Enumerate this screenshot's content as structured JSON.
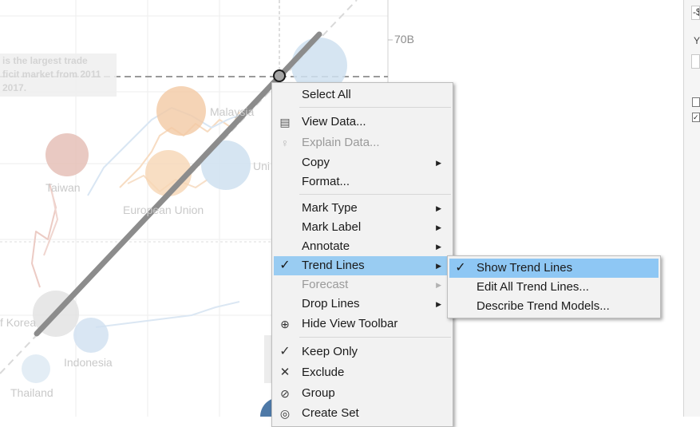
{
  "chart": {
    "y_axis_label": "70B",
    "annotation": "is the largest trade\nficit market from 2011\n2017.",
    "countries": {
      "malaysia": "Malaysia",
      "taiwan": "Taiwan",
      "european_union": "European Union",
      "united_partial": "Uni",
      "korea_partial": "f Korea",
      "indonesia": "Indonesia",
      "thailand": "Thailand"
    },
    "colors": {
      "trend_line": "#8c8c8c",
      "reference_line": "#8c8c8c",
      "bubble_orange": "#f3c9a4",
      "bubble_blue": "#c8dcef",
      "bubble_red": "#e4bbb3",
      "bubble_gray": "#e1e1e1",
      "bubble_dark_blue": "#4e79a7"
    }
  },
  "right_panel": {
    "field_top": "-$",
    "label_y": "Y",
    "check_mark": "✓"
  },
  "context_menu": {
    "items": [
      {
        "label": "Select All",
        "icon": "",
        "enabled": true
      },
      {
        "label": "View Data...",
        "icon": "table-icon",
        "enabled": true
      },
      {
        "label": "Explain Data...",
        "icon": "lightbulb-icon",
        "enabled": false
      },
      {
        "label": "Copy",
        "icon": "",
        "enabled": true,
        "submenu": true
      },
      {
        "label": "Format...",
        "icon": "",
        "enabled": true
      },
      {
        "label": "Mark Type",
        "icon": "",
        "enabled": true,
        "submenu": true
      },
      {
        "label": "Mark Label",
        "icon": "",
        "enabled": true,
        "submenu": true
      },
      {
        "label": "Annotate",
        "icon": "",
        "enabled": true,
        "submenu": true
      },
      {
        "label": "Trend Lines",
        "icon": "check-icon",
        "enabled": true,
        "submenu": true,
        "highlighted": true
      },
      {
        "label": "Forecast",
        "icon": "",
        "enabled": false,
        "submenu": true
      },
      {
        "label": "Drop Lines",
        "icon": "",
        "enabled": true,
        "submenu": true
      },
      {
        "label": "Hide View Toolbar",
        "icon": "zoom-icon",
        "enabled": true
      },
      {
        "label": "Keep Only",
        "icon": "check-icon",
        "enabled": true
      },
      {
        "label": "Exclude",
        "icon": "x-icon",
        "enabled": true
      },
      {
        "label": "Group",
        "icon": "paperclip-icon",
        "enabled": true
      },
      {
        "label": "Create Set",
        "icon": "set-icon",
        "enabled": true
      }
    ]
  },
  "submenu": {
    "items": [
      {
        "label": "Show Trend Lines",
        "icon": "check-icon",
        "highlighted": true
      },
      {
        "label": "Edit All Trend Lines...",
        "icon": ""
      },
      {
        "label": "Describe Trend Models...",
        "icon": ""
      }
    ]
  },
  "glyphs": {
    "check": "✓",
    "cross": "✕",
    "arrow": "▶",
    "table": "▤",
    "bulb": "♀",
    "zoom": "⊕",
    "clip": "⊘",
    "set": "◎"
  }
}
